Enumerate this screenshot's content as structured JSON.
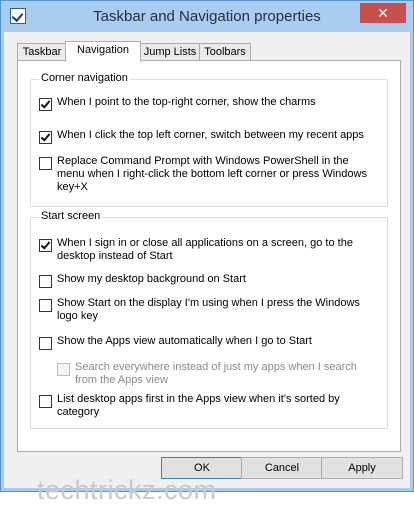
{
  "window": {
    "title": "Taskbar and Navigation properties",
    "close_glyph": "✕"
  },
  "tabs": [
    {
      "label": "Taskbar"
    },
    {
      "label": "Navigation"
    },
    {
      "label": "Jump Lists"
    },
    {
      "label": "Toolbars"
    }
  ],
  "corner": {
    "title": "Corner navigation",
    "options": [
      {
        "label": "When I point to the top-right corner, show the charms",
        "checked": true
      },
      {
        "label": "When I click the top left corner, switch between my recent apps",
        "checked": true
      },
      {
        "label": "Replace Command Prompt with Windows PowerShell in the menu when I right-click the bottom left corner or press Windows key+X",
        "checked": false
      }
    ]
  },
  "start": {
    "title": "Start screen",
    "options": [
      {
        "label": "When I sign in or close all applications on a screen, go to the desktop instead of Start",
        "checked": true
      },
      {
        "label": "Show my desktop background on Start",
        "checked": false
      },
      {
        "label": "Show Start on the display I'm using when I press the Windows logo key",
        "checked": false
      },
      {
        "label": "Show the Apps view automatically when I go to Start",
        "checked": false
      },
      {
        "label": "Search everywhere instead of just my apps when I search from the Apps view",
        "checked": false,
        "disabled": true
      },
      {
        "label": "List desktop apps first in the Apps view when it's sorted by category",
        "checked": false
      }
    ]
  },
  "buttons": {
    "ok": "OK",
    "cancel": "Cancel",
    "apply": "Apply"
  },
  "watermark": "techtrickz.com"
}
